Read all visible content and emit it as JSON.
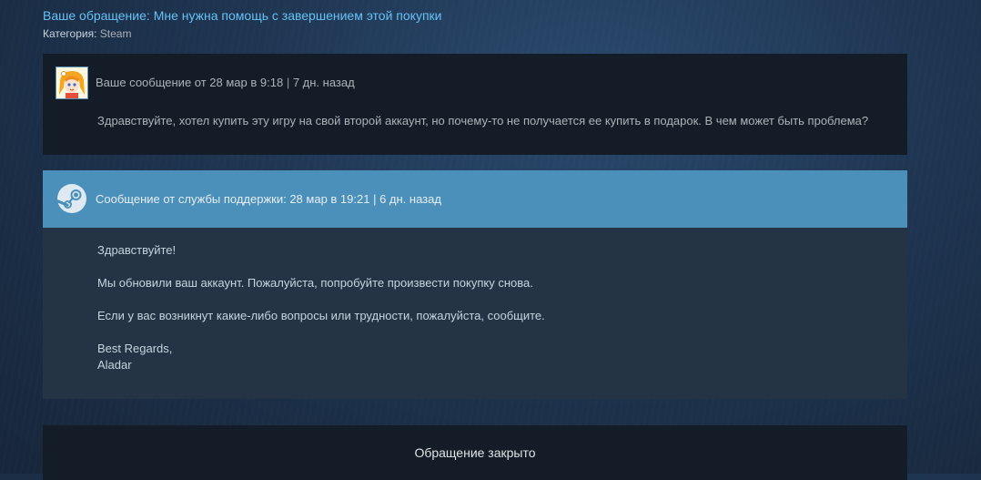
{
  "ticket": {
    "title_prefix": "Ваше обращение: ",
    "title": "Мне нужна помощь с завершением этой покупки",
    "category_label": "Категория:",
    "category_value": "Steam"
  },
  "user_message": {
    "header": "Ваше сообщение от 28 мар в 9:18",
    "separator": " | ",
    "age": "7 дн. назад",
    "body": "Здравствуйте, хотел купить эту игру на свой второй аккаунт, но почему-то не получается ее купить в подарок. В чем может быть проблема?"
  },
  "support_message": {
    "header": "Сообщение от службы поддержки: 28 мар в 19:21",
    "separator": " | ",
    "age": "6 дн. назад",
    "lines": [
      "Здравствуйте!",
      "Мы обновили ваш аккаунт. Пожалуйста, попробуйте произвести покупку снова.",
      "Если у вас возникнут какие-либо вопросы или трудности, пожалуйста, сообщите.",
      "Best Regards,",
      "Aladar"
    ]
  },
  "status": {
    "closed_text": "Обращение закрыто"
  },
  "colors": {
    "link_blue": "#67c1f5",
    "support_header_bg": "#4a90ba",
    "support_body_bg": "#253444",
    "panel_bg": "#141d27"
  },
  "icons": {
    "user_avatar": "user-avatar-icon",
    "steam_logo": "steam-logo-icon"
  }
}
